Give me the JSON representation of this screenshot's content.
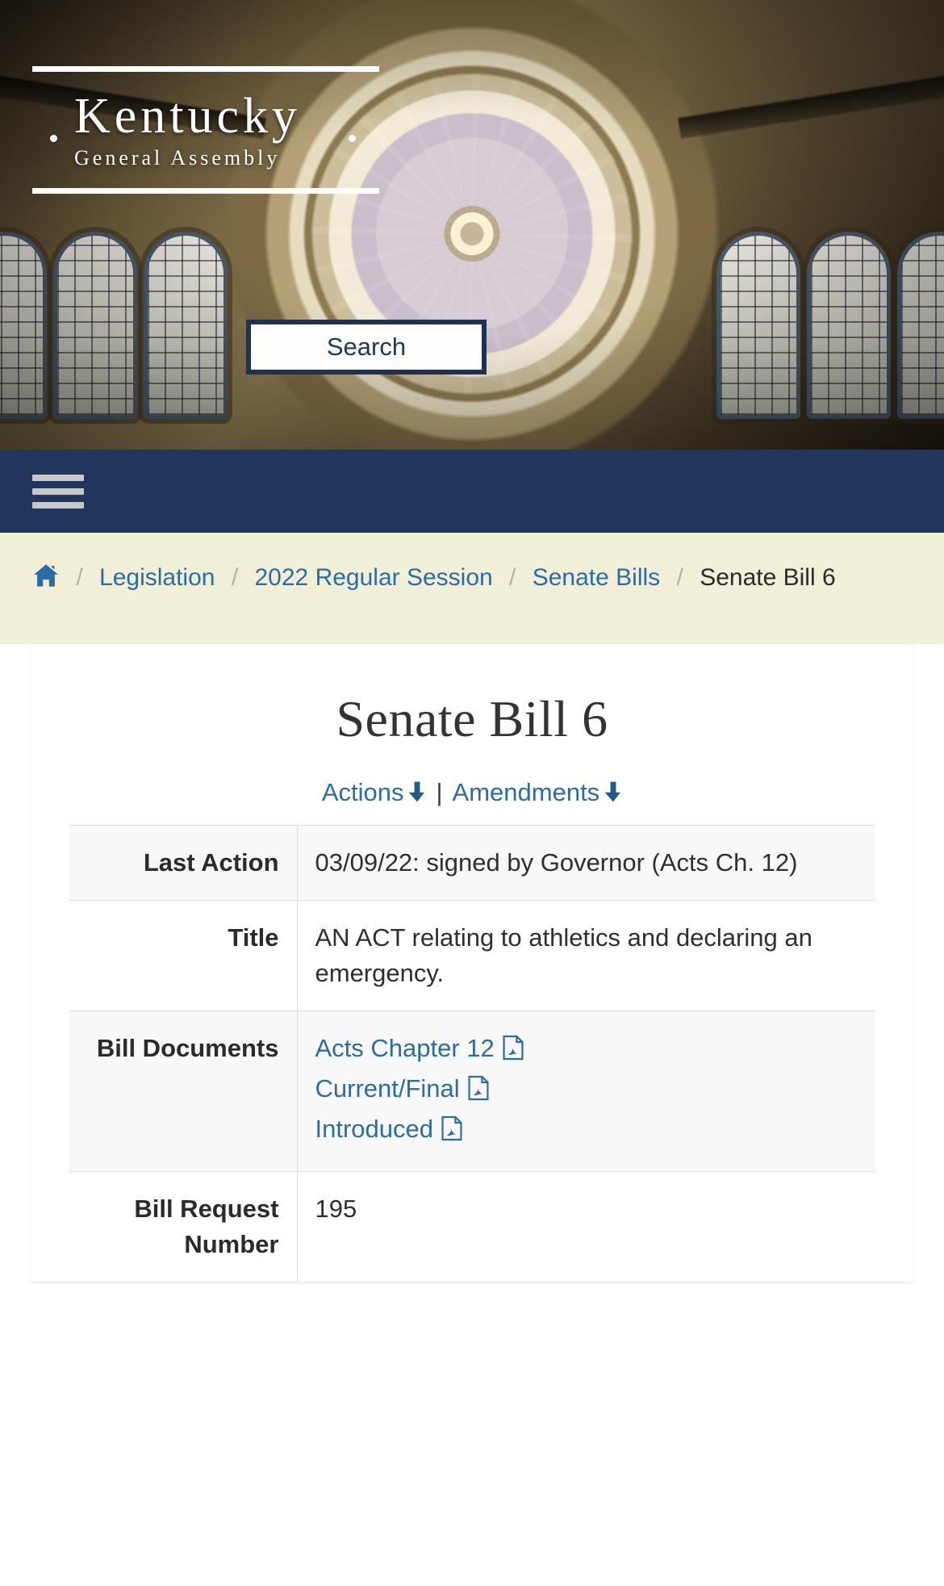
{
  "brand": {
    "name": "Kentucky",
    "subtitle": "General Assembly"
  },
  "search": {
    "label": "Search"
  },
  "nav": {
    "menu_icon": "hamburger-menu-icon"
  },
  "breadcrumb": {
    "home_icon": "home-icon",
    "separator": "/",
    "items": [
      {
        "label": "Legislation",
        "current": false
      },
      {
        "label": "2022 Regular Session",
        "current": false
      },
      {
        "label": "Senate Bills",
        "current": false
      },
      {
        "label": "Senate Bill 6",
        "current": true
      }
    ]
  },
  "page": {
    "title": "Senate Bill 6",
    "jumplinks": [
      {
        "label": "Actions",
        "icon": "arrow-down-icon"
      },
      {
        "label": "Amendments",
        "icon": "arrow-down-icon"
      }
    ],
    "jump_divider": "|"
  },
  "bill_details": {
    "rows": [
      {
        "label": "Last Action",
        "value": "03/09/22: signed by Governor (Acts Ch. 12)",
        "type": "text"
      },
      {
        "label": "Title",
        "value": "AN ACT relating to athletics and declaring an emergency.",
        "type": "text"
      },
      {
        "label": "Bill Documents",
        "type": "links",
        "links": [
          {
            "label": "Acts Chapter 12",
            "icon": "pdf-icon"
          },
          {
            "label": "Current/Final",
            "icon": "pdf-icon"
          },
          {
            "label": "Introduced",
            "icon": "pdf-icon"
          }
        ]
      },
      {
        "label": "Bill Request Number",
        "value": "195",
        "type": "text"
      }
    ]
  },
  "colors": {
    "navy": "#22355a",
    "link_blue": "#2c6ca5",
    "cream": "#f2efd8",
    "stripe": "#f8f8f8",
    "search_border": "#1f3254"
  }
}
